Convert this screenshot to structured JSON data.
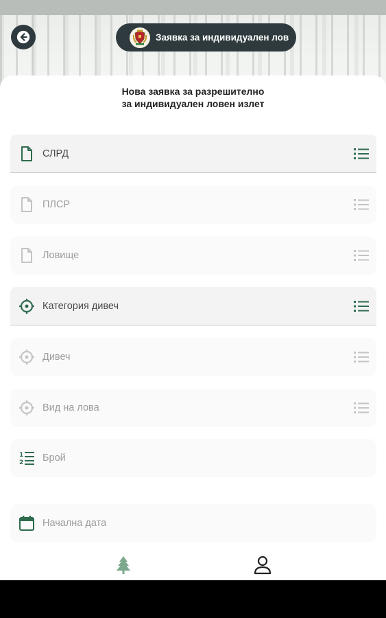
{
  "header": {
    "title": "Заявка за индивидуален лов"
  },
  "sheet": {
    "title_line1": "Нова заявка за разрешително",
    "title_line2": "за индивидуален ловен излет"
  },
  "fields": [
    {
      "label": "СЛРД",
      "icon": "document-icon",
      "active": true
    },
    {
      "label": "ПЛСР",
      "icon": "document-icon",
      "active": false
    },
    {
      "label": "Ловище",
      "icon": "document-icon",
      "active": false
    },
    {
      "label": "Категория дивеч",
      "icon": "crosshair-icon",
      "active": true
    },
    {
      "label": "Дивеч",
      "icon": "crosshair-icon",
      "active": false
    },
    {
      "label": "Вид на лова",
      "icon": "crosshair-icon",
      "active": false
    },
    {
      "label": "Брой",
      "icon": "numbered-list-icon",
      "active": false
    },
    {
      "label": "Начална дата",
      "icon": "calendar-icon",
      "active": false
    }
  ],
  "colors": {
    "accent": "#2e6b4e",
    "dark": "#2f3a3e",
    "muted_icon": "#c4c4c4",
    "nav_tree": "#7da88e"
  },
  "nav": [
    {
      "icon": "tree-icon"
    },
    {
      "icon": "person-icon"
    }
  ]
}
